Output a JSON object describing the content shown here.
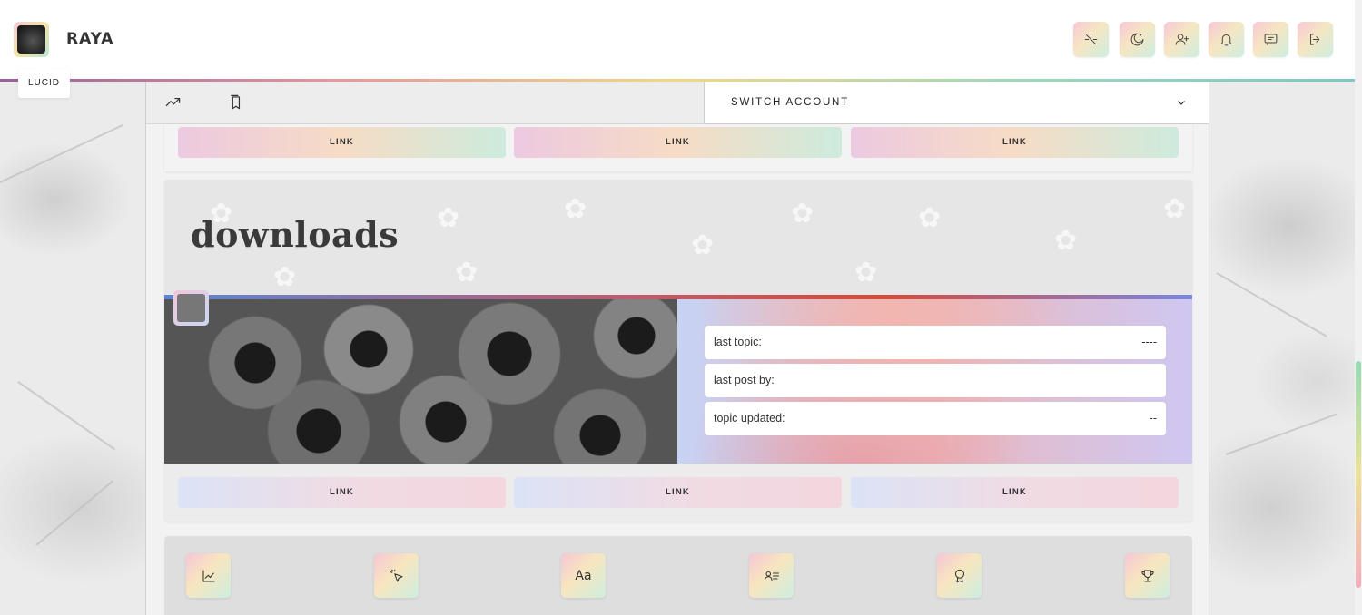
{
  "header": {
    "username": "RAYA",
    "tooltip": "LUCID",
    "buttons": [
      {
        "icon": "sparkle-off-icon"
      },
      {
        "icon": "moon-stars-icon"
      },
      {
        "icon": "user-plus-icon"
      },
      {
        "icon": "bell-icon"
      },
      {
        "icon": "message-icon"
      },
      {
        "icon": "logout-icon"
      }
    ]
  },
  "subnav": {
    "icons": [
      "trending-up-icon",
      "bookmarks-icon"
    ],
    "switch_account": "SWITCH ACCOUNT"
  },
  "top_links": [
    "LINK",
    "LINK",
    "LINK"
  ],
  "forum": {
    "title": "downloads",
    "stats": [
      {
        "label": "last topic:",
        "value": "----"
      },
      {
        "label": "last post by:",
        "value": ""
      },
      {
        "label": "topic updated:",
        "value": "--"
      }
    ],
    "links": [
      "LINK",
      "LINK",
      "LINK"
    ]
  },
  "bottom_icons": [
    {
      "icon": "chart-line-icon"
    },
    {
      "icon": "pointer-click-icon"
    },
    {
      "icon": "text-size-icon",
      "text": "Aa"
    },
    {
      "icon": "member-list-icon"
    },
    {
      "icon": "award-icon"
    },
    {
      "icon": "trophy-icon"
    }
  ],
  "colors": {
    "rainbow": [
      "#9b5f9d",
      "#e39b9b",
      "#f2d68a",
      "#9fd8b8"
    ],
    "forum_bar": [
      "#5a86d6",
      "#d64a3a",
      "#7a86e0"
    ]
  }
}
